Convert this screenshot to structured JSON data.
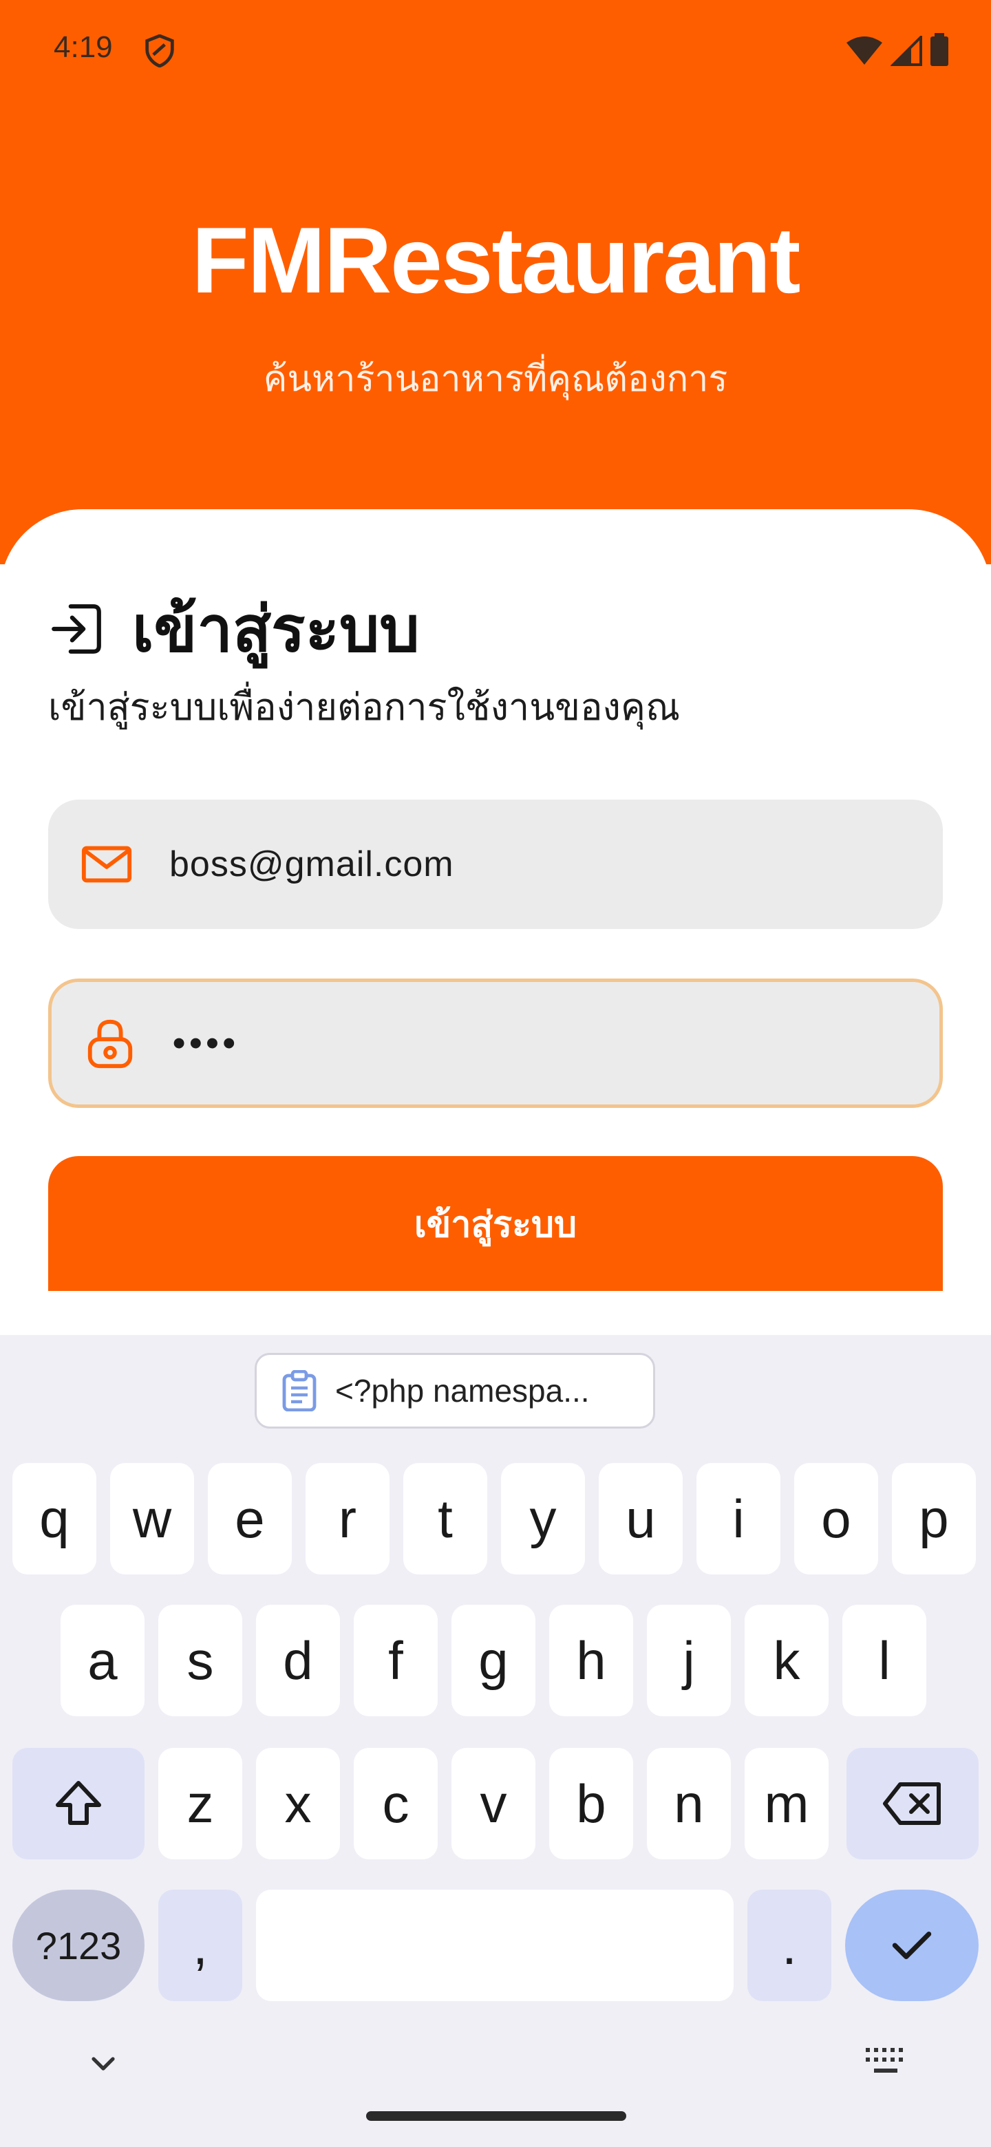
{
  "status_bar": {
    "time": "4:19",
    "icons": [
      "shield-icon",
      "wifi-icon",
      "signal-icon",
      "battery-icon"
    ]
  },
  "header": {
    "title": "FMRestaurant",
    "subtitle": "ค้นหาร้านอาหารที่คุณต้องการ"
  },
  "login": {
    "title": "เข้าสู่ระบบ",
    "description": "เข้าสู่ระบบเพื่อง่ายต่อการใช้งานของคุณ",
    "email_value": "boss@gmail.com",
    "password_value": "••••",
    "button_label": "เข้าสู่ระบบ"
  },
  "keyboard": {
    "clipboard_suggestion": "<?php  namespa...",
    "row1": [
      "q",
      "w",
      "e",
      "r",
      "t",
      "y",
      "u",
      "i",
      "o",
      "p"
    ],
    "row2": [
      "a",
      "s",
      "d",
      "f",
      "g",
      "h",
      "j",
      "k",
      "l"
    ],
    "row3": [
      "z",
      "x",
      "c",
      "v",
      "b",
      "n",
      "m"
    ],
    "symbols_label": "?123",
    "comma_label": ",",
    "period_label": "."
  },
  "colors": {
    "brand": "#ff5e00",
    "password_focus_border": "#f3c48c",
    "keyboard_bg": "#f0eff6"
  }
}
